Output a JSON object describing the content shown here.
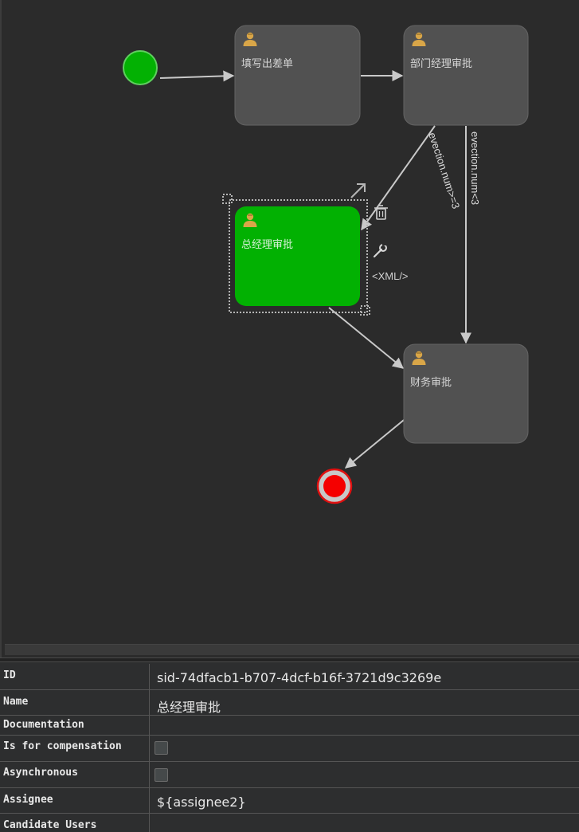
{
  "diagram": {
    "tasks": [
      {
        "id": "fill-form",
        "label": "填写出差单"
      },
      {
        "id": "dept-manager",
        "label": "部门经理审批"
      },
      {
        "id": "general-manager",
        "label": "总经理审批"
      },
      {
        "id": "finance",
        "label": "财务审批"
      }
    ],
    "edge_labels": {
      "gt_condition": "evection.num>=3",
      "lt_condition": "evection.num<3"
    },
    "context_tools": {
      "xml_label": "<XML/>"
    },
    "colors": {
      "task_fill": "#515151",
      "selected_task_fill": "#02b102",
      "start_event": "#03b103",
      "end_event": "#f50000",
      "edge": "#c9c9c9",
      "user_icon": "#d9a648"
    }
  },
  "properties": {
    "rows": [
      {
        "key": "ID",
        "value": "sid-74dfacb1-b707-4dcf-b16f-3721d9c3269e"
      },
      {
        "key": "Name",
        "value": "总经理审批"
      },
      {
        "key": "Documentation",
        "value": ""
      },
      {
        "key": "Is for compensation",
        "checked": false
      },
      {
        "key": "Asynchronous",
        "checked": false
      },
      {
        "key": "Assignee",
        "value": "${assignee2}"
      },
      {
        "key": "Candidate Users",
        "value": ""
      }
    ]
  }
}
